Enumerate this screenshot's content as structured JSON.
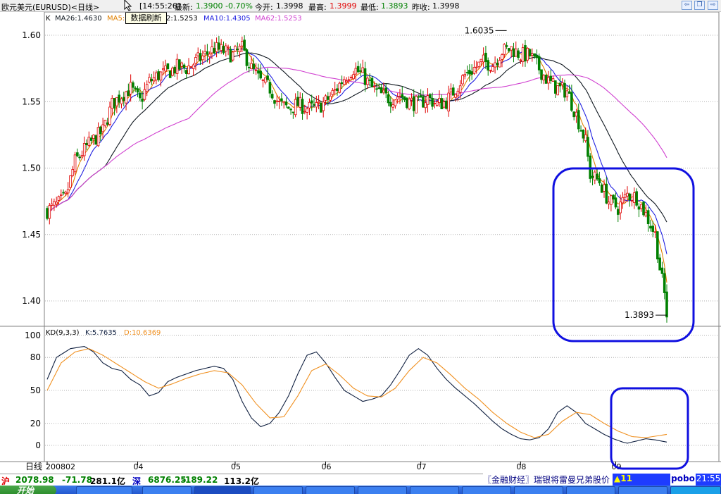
{
  "title": {
    "symbol": "欧元美元(EURUSD)<日线>",
    "time": "[14:55:26]",
    "latest_label": "最新:",
    "latest": "1.3900",
    "change": "-0.70%",
    "open_label": "今开:",
    "open": "1.3998",
    "high_label": "最高:",
    "high": "1.3999",
    "low_label": "最低:",
    "low": "1.3893",
    "prev_close_label": "昨收:",
    "prev_close": "1.3998",
    "refresh_tip": "数据刷新"
  },
  "colors": {
    "up": "#e00000",
    "down": "#008000",
    "ma5": "#e08000",
    "ma10": "#2020e0",
    "ma26": "#101820",
    "ma62": "#d040d0",
    "k": "#102040",
    "d": "#f09020",
    "highlight": "#1010e0"
  },
  "chart_data": [
    {
      "type": "candlestick",
      "legend": {
        "k": "K",
        "ma26": "MA26:1.4630",
        "ma5": "MA5:",
        "ma20": "2:1.5253",
        "ma10": "MA10:1.4305",
        "ma62": "MA62:1.5253"
      },
      "ylim": [
        1.37,
        1.615
      ],
      "yticks": [
        "1.60",
        "1.55",
        "1.50",
        "1.45",
        "1.40"
      ],
      "xticks": [
        {
          "label": "200802",
          "index": 0
        },
        {
          "label": "04",
          "index": 39
        },
        {
          "label": "05",
          "index": 81
        },
        {
          "label": "06",
          "index": 120
        },
        {
          "label": "07",
          "index": 161
        },
        {
          "label": "08",
          "index": 204
        },
        {
          "label": "09",
          "index": 245
        }
      ],
      "n_bars": 268,
      "annotations": [
        {
          "text": "1.6035",
          "index": 198,
          "value": 1.6035
        },
        {
          "text": "1.3893",
          "index": 267,
          "value": 1.3893
        }
      ],
      "waypoints": [
        [
          0,
          1.468
        ],
        [
          4,
          1.472
        ],
        [
          8,
          1.478
        ],
        [
          12,
          1.505
        ],
        [
          18,
          1.518
        ],
        [
          24,
          1.528
        ],
        [
          28,
          1.548
        ],
        [
          32,
          1.555
        ],
        [
          36,
          1.56
        ],
        [
          40,
          1.55
        ],
        [
          44,
          1.565
        ],
        [
          48,
          1.57
        ],
        [
          52,
          1.572
        ],
        [
          56,
          1.576
        ],
        [
          60,
          1.575
        ],
        [
          64,
          1.58
        ],
        [
          68,
          1.585
        ],
        [
          72,
          1.59
        ],
        [
          76,
          1.588
        ],
        [
          80,
          1.585
        ],
        [
          84,
          1.59
        ],
        [
          88,
          1.575
        ],
        [
          92,
          1.565
        ],
        [
          96,
          1.56
        ],
        [
          100,
          1.548
        ],
        [
          104,
          1.545
        ],
        [
          108,
          1.548
        ],
        [
          112,
          1.545
        ],
        [
          116,
          1.545
        ],
        [
          120,
          1.55
        ],
        [
          124,
          1.558
        ],
        [
          128,
          1.568
        ],
        [
          132,
          1.575
        ],
        [
          136,
          1.57
        ],
        [
          140,
          1.56
        ],
        [
          144,
          1.555
        ],
        [
          148,
          1.552
        ],
        [
          152,
          1.555
        ],
        [
          156,
          1.55
        ],
        [
          160,
          1.548
        ],
        [
          164,
          1.553
        ],
        [
          168,
          1.548
        ],
        [
          172,
          1.55
        ],
        [
          176,
          1.56
        ],
        [
          180,
          1.57
        ],
        [
          184,
          1.575
        ],
        [
          188,
          1.58
        ],
        [
          192,
          1.578
        ],
        [
          196,
          1.588
        ],
        [
          200,
          1.59
        ],
        [
          204,
          1.585
        ],
        [
          208,
          1.585
        ],
        [
          212,
          1.575
        ],
        [
          216,
          1.565
        ],
        [
          220,
          1.56
        ],
        [
          224,
          1.558
        ],
        [
          228,
          1.54
        ],
        [
          232,
          1.52
        ],
        [
          234,
          1.495
        ],
        [
          238,
          1.49
        ],
        [
          242,
          1.475
        ],
        [
          246,
          1.47
        ],
        [
          250,
          1.48
        ],
        [
          254,
          1.478
        ],
        [
          258,
          1.465
        ],
        [
          262,
          1.45
        ],
        [
          264,
          1.425
        ],
        [
          266,
          1.405
        ],
        [
          267,
          1.39
        ]
      ]
    },
    {
      "type": "line",
      "title": "KD(9,3,3)",
      "k_label": "K:5.7635",
      "d_label": "D:10.6369",
      "ylim": [
        0,
        100
      ],
      "yticks": [
        100,
        80,
        50,
        20,
        0
      ],
      "series": [
        {
          "name": "K",
          "waypoints": [
            [
              0,
              60
            ],
            [
              4,
              80
            ],
            [
              10,
              88
            ],
            [
              16,
              90
            ],
            [
              20,
              85
            ],
            [
              24,
              75
            ],
            [
              28,
              70
            ],
            [
              32,
              68
            ],
            [
              36,
              60
            ],
            [
              40,
              55
            ],
            [
              44,
              45
            ],
            [
              48,
              48
            ],
            [
              52,
              58
            ],
            [
              56,
              62
            ],
            [
              60,
              65
            ],
            [
              64,
              68
            ],
            [
              68,
              70
            ],
            [
              72,
              72
            ],
            [
              76,
              70
            ],
            [
              80,
              60
            ],
            [
              84,
              40
            ],
            [
              88,
              25
            ],
            [
              92,
              17
            ],
            [
              96,
              20
            ],
            [
              100,
              30
            ],
            [
              104,
              45
            ],
            [
              108,
              65
            ],
            [
              112,
              82
            ],
            [
              116,
              85
            ],
            [
              120,
              75
            ],
            [
              124,
              62
            ],
            [
              128,
              50
            ],
            [
              132,
              45
            ],
            [
              136,
              40
            ],
            [
              140,
              42
            ],
            [
              144,
              45
            ],
            [
              148,
              55
            ],
            [
              152,
              68
            ],
            [
              156,
              82
            ],
            [
              160,
              88
            ],
            [
              164,
              82
            ],
            [
              168,
              70
            ],
            [
              172,
              60
            ],
            [
              176,
              52
            ],
            [
              180,
              45
            ],
            [
              184,
              38
            ],
            [
              188,
              30
            ],
            [
              192,
              22
            ],
            [
              196,
              15
            ],
            [
              200,
              10
            ],
            [
              204,
              6
            ],
            [
              208,
              5
            ],
            [
              212,
              7
            ],
            [
              216,
              15
            ],
            [
              220,
              30
            ],
            [
              224,
              36
            ],
            [
              228,
              30
            ],
            [
              232,
              20
            ],
            [
              236,
              15
            ],
            [
              240,
              10
            ],
            [
              244,
              6
            ],
            [
              248,
              3
            ],
            [
              250,
              2
            ],
            [
              254,
              4
            ],
            [
              258,
              6
            ],
            [
              262,
              5
            ],
            [
              267,
              3
            ]
          ]
        },
        {
          "name": "D",
          "waypoints": [
            [
              0,
              50
            ],
            [
              6,
              75
            ],
            [
              12,
              85
            ],
            [
              18,
              88
            ],
            [
              24,
              82
            ],
            [
              30,
              74
            ],
            [
              36,
              66
            ],
            [
              42,
              58
            ],
            [
              48,
              52
            ],
            [
              54,
              56
            ],
            [
              60,
              61
            ],
            [
              66,
              65
            ],
            [
              72,
              68
            ],
            [
              78,
              66
            ],
            [
              84,
              55
            ],
            [
              90,
              38
            ],
            [
              96,
              25
            ],
            [
              102,
              26
            ],
            [
              108,
              45
            ],
            [
              114,
              68
            ],
            [
              120,
              74
            ],
            [
              126,
              64
            ],
            [
              132,
              52
            ],
            [
              138,
              45
            ],
            [
              144,
              44
            ],
            [
              150,
              52
            ],
            [
              156,
              68
            ],
            [
              162,
              80
            ],
            [
              168,
              75
            ],
            [
              174,
              64
            ],
            [
              180,
              52
            ],
            [
              186,
              42
            ],
            [
              192,
              30
            ],
            [
              198,
              20
            ],
            [
              204,
              12
            ],
            [
              210,
              7
            ],
            [
              216,
              10
            ],
            [
              222,
              22
            ],
            [
              228,
              30
            ],
            [
              234,
              28
            ],
            [
              240,
              20
            ],
            [
              246,
              13
            ],
            [
              252,
              8
            ],
            [
              258,
              7
            ],
            [
              264,
              9
            ],
            [
              267,
              10
            ]
          ]
        }
      ]
    }
  ],
  "statusbar": {
    "sh_label": "沪",
    "sh_index": "2078.98",
    "sh_change": "-71.78",
    "sh_volume": "281.1亿",
    "sz_label": "深",
    "sz_index": "6876.25",
    "sz_change": "-189.22",
    "sz_volume": "113.2亿",
    "news": "〖金融财经〗瑞银将雷曼兄弟股价",
    "alert": "▲11",
    "brand": "pobo",
    "clock": "21:55"
  },
  "x_axis_label": "日线",
  "taskbar": {
    "start_label": "开始"
  }
}
